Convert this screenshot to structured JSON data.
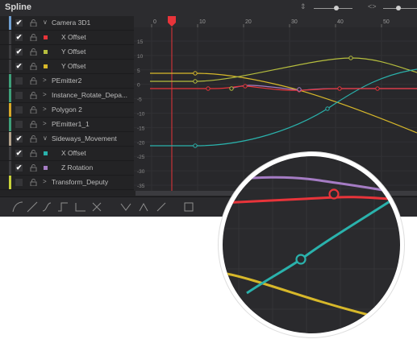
{
  "window": {
    "title": "Spline"
  },
  "header": {
    "zoom_icons": [
      "updown-arrows-icon",
      "horizontal-arrows-icon"
    ]
  },
  "colors": {
    "red": "#e8343a",
    "yellow": "#d7b82a",
    "olive": "#b6be3e",
    "teal": "#2ab2ac",
    "purple": "#a57cc4",
    "playhead": "#e8343a"
  },
  "ruler": {
    "ticks": [
      "0",
      "10",
      "20",
      "30",
      "40",
      "50"
    ]
  },
  "y_axis": {
    "ticks": [
      "15",
      "10",
      "5",
      "0",
      "-5",
      "-10",
      "-15",
      "-20",
      "-25",
      "-30",
      "-35"
    ]
  },
  "tree": {
    "rows": [
      {
        "label": "Camera 3D1",
        "checked": true,
        "expanded": true,
        "strip_color": "#6f9ecf",
        "swatch": null
      },
      {
        "label": "X Offset",
        "checked": true,
        "expanded": null,
        "strip_color": "#3c3c3f",
        "swatch": "#e8343a"
      },
      {
        "label": "Y Offset",
        "checked": true,
        "expanded": null,
        "strip_color": "#3c3c3f",
        "swatch": "#b6be3e"
      },
      {
        "label": "Y Offset",
        "checked": true,
        "expanded": null,
        "strip_color": "#3c3c3f",
        "swatch": "#d7b82a"
      },
      {
        "label": "PEmitter2",
        "checked": false,
        "expanded": false,
        "strip_color": "#3fa07a",
        "swatch": null
      },
      {
        "label": "Instance_Rotate_Depa...",
        "checked": false,
        "expanded": false,
        "strip_color": "#3fa07a",
        "swatch": null
      },
      {
        "label": "Polygon 2",
        "checked": false,
        "expanded": false,
        "strip_color": "#d7a82a",
        "swatch": null
      },
      {
        "label": "PEmitter1_1",
        "checked": false,
        "expanded": false,
        "strip_color": "#3fa07a",
        "swatch": null
      },
      {
        "label": "Sideways_Movement",
        "checked": true,
        "expanded": true,
        "strip_color": "#b0a08a",
        "swatch": null
      },
      {
        "label": "X Offset",
        "checked": true,
        "expanded": null,
        "strip_color": "#3c3c3f",
        "swatch": "#2ab2ac"
      },
      {
        "label": "Z Rotation",
        "checked": true,
        "expanded": null,
        "strip_color": "#3c3c3f",
        "swatch": "#a57cc4"
      },
      {
        "label": "Transform_Deputy",
        "checked": false,
        "expanded": false,
        "strip_color": "#c9d23a",
        "swatch": null
      }
    ]
  },
  "toolbar": {
    "tools": [
      "smooth-icon",
      "linear-icon",
      "invert-icon",
      "step-in-icon",
      "step-out-icon",
      "reverse-icon",
      "ease-in-icon",
      "ease-out-icon",
      "time-stretch-icon",
      "shape-box-icon"
    ]
  }
}
